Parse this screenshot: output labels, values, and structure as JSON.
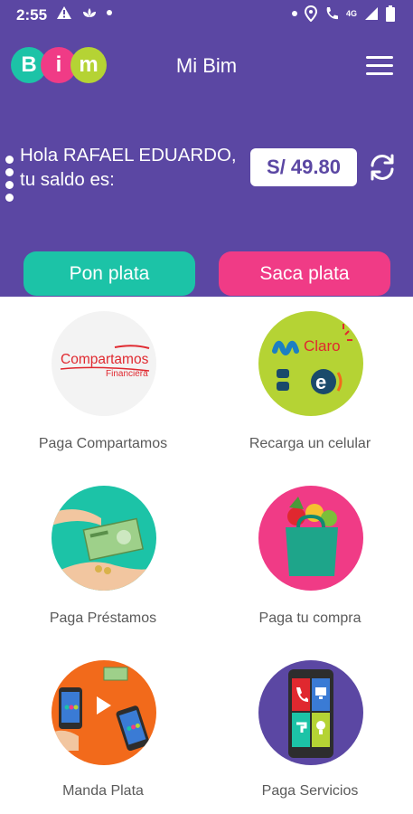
{
  "status_bar": {
    "time": "2:55",
    "network": "4G"
  },
  "app_bar": {
    "logo_letters": [
      "B",
      "i",
      "m"
    ],
    "title": "Mi Bim"
  },
  "account": {
    "greeting": "Hola RAFAEL EDUARDO, tu saldo es:",
    "balance": "S/ 49.80"
  },
  "actions": {
    "pon_label": "Pon plata",
    "saca_label": "Saca plata"
  },
  "services": [
    {
      "label": "Paga Compartamos",
      "icon": "compartamos-logo-icon",
      "brand_text": "Compartamos",
      "brand_sub": "Financiera"
    },
    {
      "label": "Recarga un celular",
      "icon": "carrier-logos-icon",
      "brand_text": "Claro"
    },
    {
      "label": "Paga  Préstamos",
      "icon": "hands-money-icon"
    },
    {
      "label": "Paga tu compra",
      "icon": "shopping-bag-icon"
    },
    {
      "label": "Manda Plata",
      "icon": "phone-transfer-icon"
    },
    {
      "label": "Paga Servicios",
      "icon": "phone-services-icon"
    }
  ],
  "colors": {
    "header_bg": "#5b47a3",
    "accent_teal": "#1cc3a7",
    "accent_pink": "#f03b86",
    "lime": "#b5d334",
    "orange": "#f26a1b"
  }
}
